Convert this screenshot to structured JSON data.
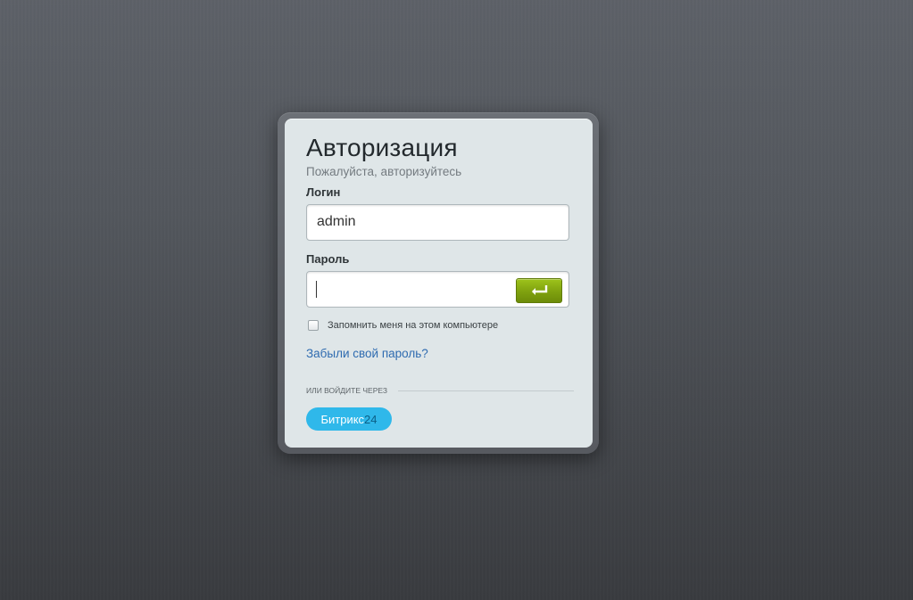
{
  "auth": {
    "title": "Авторизация",
    "subtitle": "Пожалуйста, авторизуйтесь",
    "login_label": "Логин",
    "login_value": "admin",
    "password_label": "Пароль",
    "password_value": "",
    "submit_icon": "enter-return-icon",
    "remember_label": "Запомнить меня на этом компьютере",
    "remember_checked": false,
    "forgot_link": "Забыли свой пароль?",
    "or_label": "или войдите через",
    "bitrix_label": "Битрикс",
    "bitrix_number": "24"
  },
  "colors": {
    "accent_green": "#7fa10f",
    "bitrix_blue": "#2fb8ea",
    "link_blue": "#2e6bb0"
  }
}
